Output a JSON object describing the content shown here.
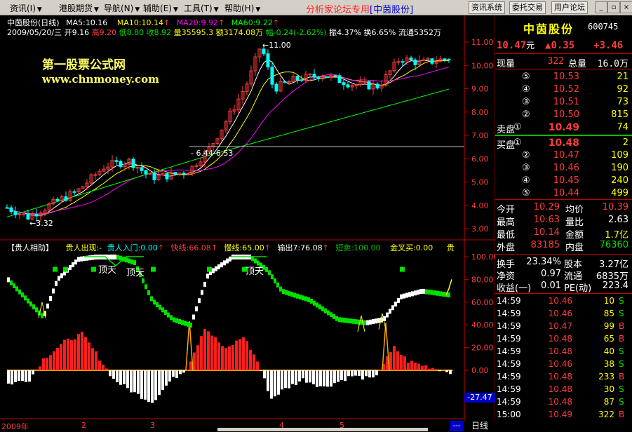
{
  "menu": {
    "items": [
      "资讯(I)",
      "港股期货",
      "导航(N)",
      "辅助(E)",
      "工具(T)",
      "帮助(H)"
    ],
    "title_prefix": "分析家论坛专用",
    "title_stock": "[中茵股份]",
    "buttons": [
      "资讯系统",
      "委托交易",
      "用户论坛"
    ]
  },
  "main_header": {
    "line1": [
      {
        "text": "中茵股份(日线)",
        "color": "#ffffff"
      },
      {
        "text": "MA5:10.16",
        "color": "#ffffff"
      },
      {
        "text": "MA10:10.14",
        "color": "#ffff00"
      },
      {
        "text": "MA20:9.92",
        "color": "#ff00ff"
      },
      {
        "text": "MA60:9.22",
        "color": "#00ff00"
      }
    ],
    "line2": [
      {
        "text": "2009/05/20/三",
        "color": "#ffffff"
      },
      {
        "text": "开9.16",
        "color": "#ffffff"
      },
      {
        "text": "高9.20",
        "color": "#ff3c3c"
      },
      {
        "text": "低8.80",
        "color": "#00e000"
      },
      {
        "text": "收8.92",
        "color": "#00e000"
      },
      {
        "text": "量35595.3",
        "color": "#ffff00"
      },
      {
        "text": "额3174.08万",
        "color": "#ffff00"
      },
      {
        "text": "幅-0.24(-2.62%)",
        "color": "#00e000"
      },
      {
        "text": "振4.37%",
        "color": "#ffffff"
      },
      {
        "text": "换6.65%",
        "color": "#ffffff"
      },
      {
        "text": "流通5352万",
        "color": "#ffffff"
      }
    ]
  },
  "watermark": {
    "line1": "第一股票公式网",
    "line2": "www.chnmoney.com"
  },
  "price_annotations": {
    "high": "11.00",
    "mid": "6.44-6.53",
    "low": "3.32"
  },
  "price_axis": [
    "11.00",
    "10.00",
    "9.00",
    "8.00",
    "7.00",
    "6.00",
    "5.00",
    "4.00",
    "3.00"
  ],
  "indicator_header": [
    {
      "text": "【贵人相助】",
      "color": "#ffffff"
    },
    {
      "text": "贵人出现:-",
      "color": "#ffff00"
    },
    {
      "text": "贵人入门:0.00",
      "color": "#00ffff"
    },
    {
      "text": "快线:66.08",
      "color": "#ff3c3c"
    },
    {
      "text": "慢线:65.00",
      "color": "#ffff00"
    },
    {
      "text": "输出7:76.08",
      "color": "#ffffff"
    },
    {
      "text": "短卖:100.00",
      "color": "#00c000"
    },
    {
      "text": "金叉买:0.00",
      "color": "#ffff00"
    },
    {
      "text": "贵",
      "color": "#ffff00"
    }
  ],
  "indicator_labels": [
    "顶天",
    "顶天",
    "顶天"
  ],
  "indicator_axis": [
    "100.00",
    "80.00",
    "60.00",
    "40.00",
    "20.00",
    "0.00"
  ],
  "indicator_current": "-27.47",
  "bottom": {
    "year": "2009年",
    "months": [
      "2",
      "3",
      "4",
      "5"
    ],
    "tab": "日线",
    "corner": "---"
  },
  "quote": {
    "name": "中茵股份",
    "code": "600745",
    "price": "10.47",
    "price_unit": "元",
    "change": "▲0.35",
    "change_pct": "+3.46",
    "current_vol_label": "现量",
    "current_vol": "322",
    "total_vol_label": "总量",
    "total_vol": "16.0万",
    "asks": [
      {
        "level": "⑤",
        "price": "10.53",
        "vol": "21"
      },
      {
        "level": "④",
        "price": "10.52",
        "vol": "92"
      },
      {
        "level": "③",
        "price": "10.51",
        "vol": "73"
      },
      {
        "level": "②",
        "price": "10.50",
        "vol": "815"
      },
      {
        "level": "①",
        "price": "10.49",
        "vol": "74"
      }
    ],
    "ask_label": "卖盘",
    "bid_label": "买盘",
    "bids": [
      {
        "level": "①",
        "price": "10.48",
        "vol": "2"
      },
      {
        "level": "②",
        "price": "10.47",
        "vol": "109"
      },
      {
        "level": "③",
        "price": "10.46",
        "vol": "190"
      },
      {
        "level": "④",
        "price": "10.45",
        "vol": "240"
      },
      {
        "level": "⑤",
        "price": "10.44",
        "vol": "499"
      }
    ],
    "stats": [
      {
        "l1": "今开",
        "v1": "10.29",
        "c1": "#ff3c3c",
        "l2": "均价",
        "v2": "10.39",
        "c2": "#ff3c3c"
      },
      {
        "l1": "最高",
        "v1": "10.63",
        "c1": "#ff3c3c",
        "l2": "量比",
        "v2": "2.63",
        "c2": "#ffffff"
      },
      {
        "l1": "最低",
        "v1": "10.14",
        "c1": "#ff3c3c",
        "l2": "金额",
        "v2": "1.7亿",
        "c2": "#ffff00"
      },
      {
        "l1": "外盘",
        "v1": "83185",
        "c1": "#ff3c3c",
        "l2": "内盘",
        "v2": "76360",
        "c2": "#00e000"
      }
    ],
    "stats2": [
      {
        "l1": "换手",
        "v1": "23.34%",
        "l2": "股本",
        "v2": "3.27亿"
      },
      {
        "l1": "净资",
        "v1": "0.97",
        "l2": "流通",
        "v2": "6835万"
      },
      {
        "l1": "收益(一)",
        "v1": "0.01",
        "l2": "PE(动)",
        "v2": "223.4"
      }
    ],
    "ticks": [
      {
        "t": "14:59",
        "p": "10.46",
        "v": "10",
        "d": "S"
      },
      {
        "t": "14:59",
        "p": "10.46",
        "v": "85",
        "d": "S"
      },
      {
        "t": "14:59",
        "p": "10.47",
        "v": "99",
        "d": "B"
      },
      {
        "t": "14:59",
        "p": "10.48",
        "v": "65",
        "d": "B"
      },
      {
        "t": "14:59",
        "p": "10.48",
        "v": "40",
        "d": "S"
      },
      {
        "t": "14:59",
        "p": "10.46",
        "v": "38",
        "d": "S"
      },
      {
        "t": "14:59",
        "p": "10.48",
        "v": "233",
        "d": "B"
      },
      {
        "t": "14:59",
        "p": "10.48",
        "v": "30",
        "d": "S"
      },
      {
        "t": "14:59",
        "p": "10.48",
        "v": "87",
        "d": "S"
      },
      {
        "t": "15:00",
        "p": "10.49",
        "v": "322",
        "d": "B"
      }
    ]
  }
}
